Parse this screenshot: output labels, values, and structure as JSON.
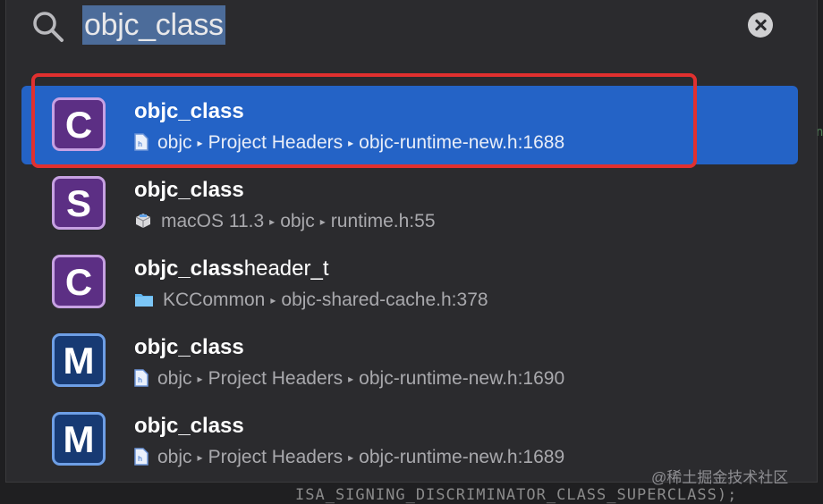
{
  "search": {
    "query": "objc_class"
  },
  "results": [
    {
      "badge": "C",
      "title_match": "objc_class",
      "title_rest": "",
      "path": [
        "objc",
        "Project Headers",
        "objc-runtime-new.h:1688"
      ],
      "file_icon": "header-file-icon"
    },
    {
      "badge": "S",
      "title_match": "objc_class",
      "title_rest": "",
      "path": [
        "macOS 11.3",
        "objc",
        "runtime.h:55"
      ],
      "file_icon": "sdk-package-icon"
    },
    {
      "badge": "C",
      "title_match": "objc_class",
      "title_rest": "header_t",
      "path": [
        "KCCommon",
        "objc-shared-cache.h:378"
      ],
      "file_icon": "folder-icon"
    },
    {
      "badge": "M",
      "title_match": "objc_class",
      "title_rest": "",
      "path": [
        "objc",
        "Project Headers",
        "objc-runtime-new.h:1690"
      ],
      "file_icon": "header-file-icon"
    },
    {
      "badge": "M",
      "title_match": "objc_class",
      "title_rest": "",
      "path": [
        "objc",
        "Project Headers",
        "objc-runtime-new.h:1689"
      ],
      "file_icon": "header-file-icon"
    }
  ],
  "background_code": "ISA_SIGNING_DISCRIMINATOR_CLASS_SUPERCLASS);",
  "watermark": "@稀土掘金技术社区",
  "colors": {
    "selection": "#2463c6",
    "highlight_border": "#e1302f",
    "purple_badge": "#5c2f84",
    "blue_badge": "#173a73"
  }
}
